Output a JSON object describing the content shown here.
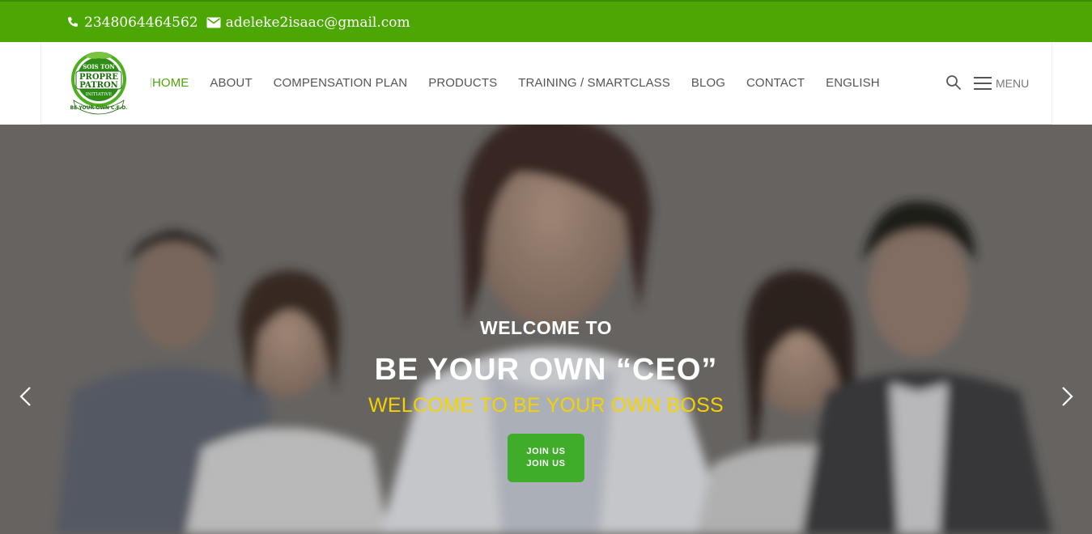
{
  "topbar": {
    "phone": "2348064464562",
    "email": "adeleke2isaac@gmail.com",
    "icons": [
      "phone-icon",
      "envelope-icon"
    ]
  },
  "header": {
    "logo": {
      "top_text": "SOIS TON",
      "mid_text": "PROPRE",
      "mid_text2": "PATRON",
      "small_text": "INITIATIVE",
      "ribbon_text": "BE YOUR OWN C.E.O."
    },
    "nav": [
      {
        "label": "HOME",
        "active": true
      },
      {
        "label": "ABOUT"
      },
      {
        "label": "COMPENSATION PLAN"
      },
      {
        "label": "PRODUCTS"
      },
      {
        "label": "TRAINING / SMARTCLASS"
      },
      {
        "label": "BLOG"
      },
      {
        "label": "CONTACT"
      },
      {
        "label": "ENGLISH"
      }
    ],
    "menu_label": "MENU"
  },
  "hero": {
    "welcome": "WELCOME TO",
    "title": "BE YOUR OWN “CEO”",
    "subtitle": "WELCOME TO BE YOUR OWN BOSS",
    "button_line1": "JOIN US",
    "button_line2": "JOIN US"
  },
  "colors": {
    "brand_green": "#4ca604",
    "button_green": "#3fac2a",
    "subtitle_yellow": "#f2d300",
    "nav_text": "#555555"
  }
}
